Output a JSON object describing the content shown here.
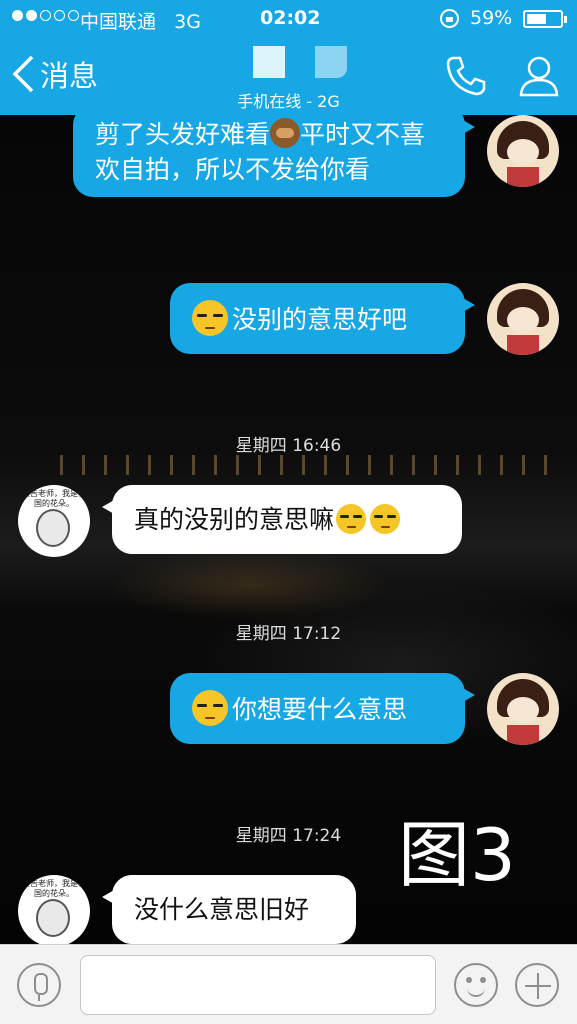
{
  "status_bar": {
    "carrier": "中国联通",
    "network": "3G",
    "time": "02:02",
    "battery_pct": "59%",
    "battery_level": 0.59
  },
  "header": {
    "back_label": "消息",
    "contact_status": "手机在线 - 2G"
  },
  "messages": [
    {
      "type": "out",
      "text_a": "剪了头发好难看",
      "emoji": "hear-no-evil-monkey",
      "text_b": "平时又不喜欢自拍，所以不发给你看"
    },
    {
      "type": "out",
      "emoji": "sweat-smile",
      "text": "没别的意思好吧"
    },
    {
      "type": "time",
      "text": "星期四 16:46"
    },
    {
      "type": "in",
      "text": "真的没别的意思嘛",
      "emoji": "unamused-x2"
    },
    {
      "type": "time",
      "text": "星期四 17:12"
    },
    {
      "type": "out",
      "emoji": "sweat-smile",
      "text": "你想要什么意思"
    },
    {
      "type": "time",
      "text": "星期四 17:24"
    },
    {
      "type": "in",
      "text": "没什么意思旧好"
    }
  ],
  "meme_avatar_text": "报告老师，我是祖国的花朵。",
  "watermark": "图3",
  "input_bar": {
    "placeholder": ""
  },
  "colors": {
    "accent": "#17a7e4",
    "bubble_in": "#ffffff"
  }
}
